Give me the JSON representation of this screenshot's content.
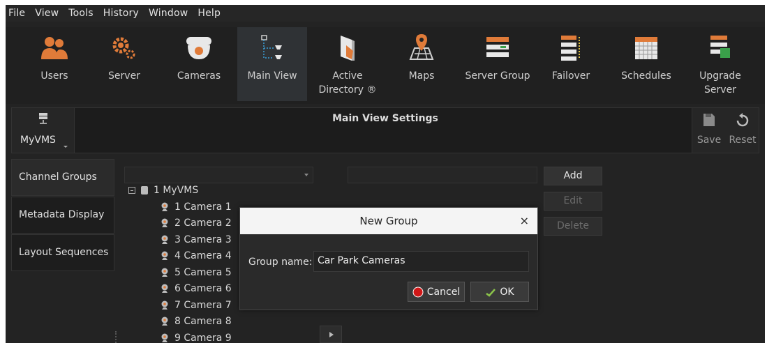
{
  "menu": [
    "File",
    "View",
    "Tools",
    "History",
    "Window",
    "Help"
  ],
  "toolbar": [
    {
      "label": "Users",
      "icon": "users-icon"
    },
    {
      "label": "Server",
      "icon": "server-gear-icon"
    },
    {
      "label": "Cameras",
      "icon": "camera-dome-icon"
    },
    {
      "label": "Main View",
      "icon": "main-view-icon",
      "active": true
    },
    {
      "label": "Active\nDirectory ®",
      "icon": "active-directory-icon"
    },
    {
      "label": "Maps",
      "icon": "map-pin-icon"
    },
    {
      "label": "Server Group",
      "icon": "server-group-icon"
    },
    {
      "label": "Failover",
      "icon": "failover-icon"
    },
    {
      "label": "Schedules",
      "icon": "calendar-icon"
    },
    {
      "label": "Upgrade\nServer",
      "icon": "upgrade-server-icon"
    }
  ],
  "header": {
    "server_name": "MyVMS",
    "title": "Main View Settings",
    "save_label": "Save",
    "reset_label": "Reset"
  },
  "sidebar": {
    "tabs": [
      "Channel Groups",
      "Metadata Display",
      "Layout Sequences"
    ],
    "selected": 0
  },
  "tree": {
    "root": "1 MyVMS",
    "cameras": [
      "1 Camera 1",
      "2 Camera 2",
      "3 Camera 3",
      "4 Camera 4",
      "5 Camera 5",
      "6 Camera 6",
      "7 Camera 7",
      "8 Camera 8",
      "9 Camera 9"
    ]
  },
  "group_buttons": {
    "add": "Add",
    "edit": "Edit",
    "delete": "Delete"
  },
  "dialog": {
    "title": "New Group",
    "close": "×",
    "field_label": "Group name:",
    "field_value": "Car Park Cameras",
    "cancel_label": "Cancel",
    "ok_label": "OK"
  },
  "colors": {
    "accent_orange": "#e07b39",
    "background": "#232323",
    "active_tab": "#2f3235"
  }
}
